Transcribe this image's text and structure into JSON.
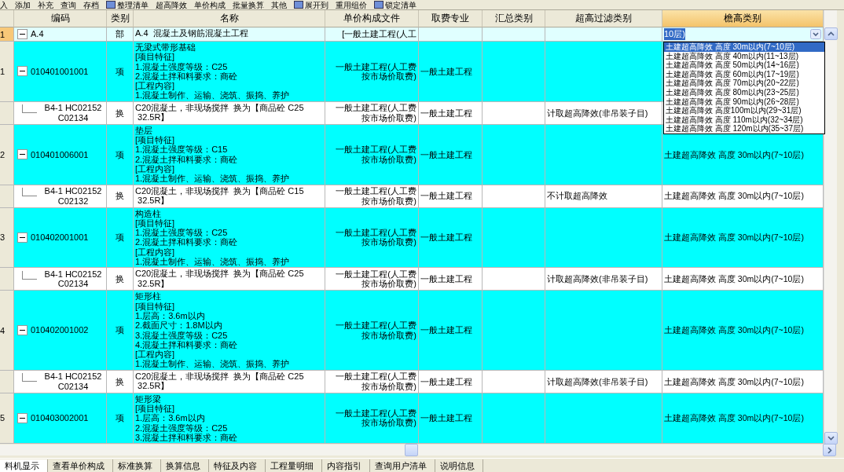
{
  "toolbar": [
    {
      "label": "入"
    },
    {
      "label": "添加"
    },
    {
      "label": "补充"
    },
    {
      "label": "查询"
    },
    {
      "label": "存档"
    },
    {
      "label": "整理清单",
      "icon": true
    },
    {
      "label": "超高降效"
    },
    {
      "label": "单价构成"
    },
    {
      "label": "批量换算"
    },
    {
      "label": "其他"
    },
    {
      "label": "展开到",
      "icon": true
    },
    {
      "label": "重用组价"
    },
    {
      "label": "锁定清单",
      "icon": true
    }
  ],
  "table": {
    "columns": [
      {
        "label": "编码",
        "selected": false
      },
      {
        "label": "类别",
        "selected": false
      },
      {
        "label": "名称",
        "selected": false
      },
      {
        "label": "单价构成文件",
        "selected": false
      },
      {
        "label": "取费专业",
        "selected": false
      },
      {
        "label": "汇总类别",
        "selected": false
      },
      {
        "label": "超高过滤类别",
        "selected": false
      },
      {
        "label": "檐高类别",
        "selected": true
      }
    ],
    "rows": [
      {
        "kind": "section",
        "selected": true,
        "number": "1",
        "expanded": true,
        "code": "A.4",
        "type": "部",
        "name": [
          "A.4  混凝土及钢筋混凝土工程"
        ],
        "file": "[一般土建工程(人工",
        "editor": "10层)"
      },
      {
        "kind": "item",
        "selected": false,
        "number": "1",
        "expanded": true,
        "code": "010401001001",
        "type": "项",
        "name": [
          "无梁式带形基础",
          "[项目特征]",
          "1.混凝土强度等级：C25",
          "2.混凝土拌和料要求：商砼",
          "[工程内容]",
          "1.混凝土制作、运输、浇筑、振捣、养护"
        ],
        "file": "一般土建工程(人工费按市场价取费)",
        "fee": "一般土建工程"
      },
      {
        "kind": "sub",
        "selected": false,
        "code": "B4-1 HC02152 C02134",
        "type": "换",
        "name": [
          "C20混凝土，非现场搅拌  换为【商品砼 C25",
          " 32.5R】"
        ],
        "file": "一般土建工程(人工费按市场价取费)",
        "fee": "一般土建工程",
        "filter": "计取超高降效(非吊装子目)"
      },
      {
        "kind": "item",
        "selected": false,
        "number": "2",
        "expanded": true,
        "code": "010401006001",
        "type": "项",
        "name": [
          "垫层",
          "[项目特征]",
          "1.混凝土强度等级：C15",
          "2.混凝土拌和料要求：商砼",
          "[工程内容]",
          "1.混凝土制作、运输、浇筑、振捣、养护"
        ],
        "file": "一般土建工程(人工费按市场价取费)",
        "fee": "一般土建工程",
        "height": "土建超高降效 高度 30m以内(7~10层)"
      },
      {
        "kind": "sub",
        "selected": false,
        "code": "B4-1 HC02152 C02132",
        "type": "换",
        "name": [
          "C20混凝土，非现场搅拌  换为【商品砼 C15",
          " 32.5R】"
        ],
        "file": "一般土建工程(人工费按市场价取费)",
        "fee": "一般土建工程",
        "filter": "不计取超高降效",
        "height": "土建超高降效 高度 30m以内(7~10层)"
      },
      {
        "kind": "item",
        "selected": false,
        "number": "3",
        "expanded": true,
        "code": "010402001001",
        "type": "项",
        "name": [
          "构造柱",
          "[项目特征]",
          "1.混凝土强度等级：C25",
          "2.混凝土拌和料要求：商砼",
          "[工程内容]",
          "1.混凝土制作、运输、浇筑、振捣、养护"
        ],
        "file": "一般土建工程(人工费按市场价取费)",
        "fee": "一般土建工程",
        "height": "土建超高降效 高度 30m以内(7~10层)"
      },
      {
        "kind": "sub",
        "selected": false,
        "code": "B4-1 HC02152 C02134",
        "type": "换",
        "name": [
          "C20混凝土，非现场搅拌  换为【商品砼 C25",
          " 32.5R】"
        ],
        "file": "一般土建工程(人工费按市场价取费)",
        "fee": "一般土建工程",
        "filter": "计取超高降效(非吊装子目)",
        "height": "土建超高降效 高度 30m以内(7~10层)"
      },
      {
        "kind": "item",
        "selected": false,
        "number": "4",
        "expanded": true,
        "code": "010402001002",
        "type": "项",
        "name": [
          "矩形柱",
          "[项目特征]",
          "1.层高：3.6m以内",
          "2.截面尺寸：1.8M以内",
          "3.混凝土强度等级：C25",
          "4.混凝土拌和料要求：商砼",
          "[工程内容]",
          "1.混凝土制作、运输、浇筑、振捣、养护"
        ],
        "file": "一般土建工程(人工费按市场价取费)",
        "fee": "一般土建工程",
        "height": "土建超高降效 高度 30m以内(7~10层)"
      },
      {
        "kind": "sub",
        "selected": false,
        "code": "B4-1 HC02152 C02134",
        "type": "换",
        "name": [
          "C20混凝土，非现场搅拌  换为【商品砼 C25",
          " 32.5R】"
        ],
        "file": "一般土建工程(人工费按市场价取费)",
        "fee": "一般土建工程",
        "filter": "计取超高降效(非吊装子目)",
        "height": "土建超高降效 高度 30m以内(7~10层)"
      },
      {
        "kind": "item",
        "selected": false,
        "number": "5",
        "expanded": true,
        "code": "010403002001",
        "type": "项",
        "name": [
          "矩形梁",
          "[项目特征]",
          "1.层高：3.6m以内",
          "2.混凝土强度等级：C25",
          "3.混凝土拌和料要求：商砼"
        ],
        "file": "一般土建工程(人工费按市场价取费)",
        "fee": "一般土建工程",
        "height": "土建超高降效 高度 30m以内(7~10层)"
      }
    ]
  },
  "dropdown": {
    "options": [
      {
        "label": "土建超高降效 高度 30m以内(7~10层)",
        "selected": true
      },
      {
        "label": "土建超高降效 高度 40m以内(11~13层)",
        "selected": false
      },
      {
        "label": "土建超高降效 高度 50m以内(14~16层)",
        "selected": false
      },
      {
        "label": "土建超高降效 高度 60m以内(17~19层)",
        "selected": false
      },
      {
        "label": "土建超高降效 高度 70m以内(20~22层)",
        "selected": false
      },
      {
        "label": "土建超高降效 高度 80m以内(23~25层)",
        "selected": false
      },
      {
        "label": "土建超高降效 高度 90m以内(26~28层)",
        "selected": false
      },
      {
        "label": "土建超高降效 高度100m以内(29~31层)",
        "selected": false
      },
      {
        "label": "土建超高降效 高度 110m以内(32~34层)",
        "selected": false
      },
      {
        "label": "土建超高降效 高度 120m以内(35~37层)",
        "selected": false
      }
    ]
  },
  "bottom_tabs": [
    {
      "label": "料机显示",
      "selected": true
    },
    {
      "label": "查看单价构成",
      "selected": false
    },
    {
      "label": "标准换算",
      "selected": false
    },
    {
      "label": "换算信息",
      "selected": false
    },
    {
      "label": "特征及内容",
      "selected": false
    },
    {
      "label": "工程量明细",
      "selected": false
    },
    {
      "label": "内容指引",
      "selected": false
    },
    {
      "label": "查询用户清单",
      "selected": false
    },
    {
      "label": "说明信息",
      "selected": false
    }
  ]
}
